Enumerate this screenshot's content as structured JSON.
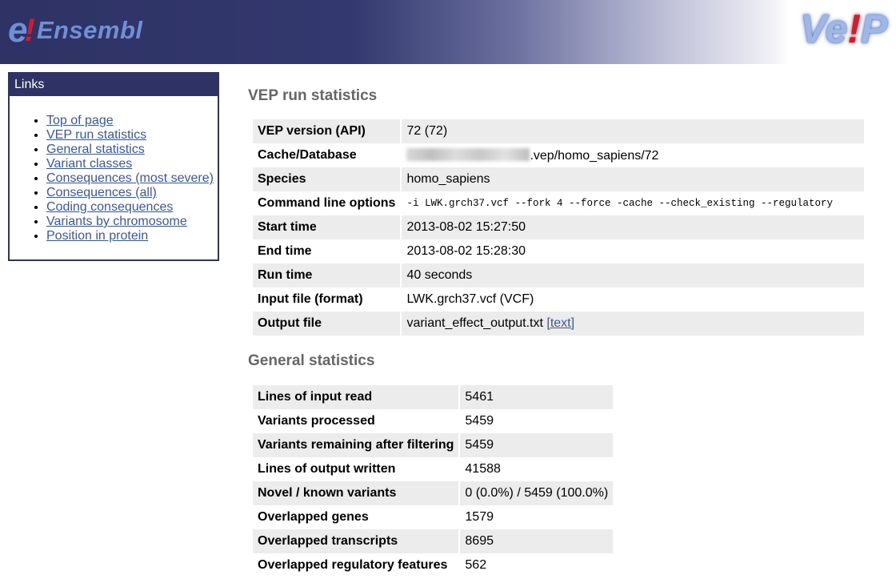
{
  "header": {
    "logo": {
      "e": "e",
      "bang": "!",
      "word": "Ensembl"
    },
    "vep_logo": {
      "prefix": "Ve",
      "bang": "!",
      "suffix": "P"
    }
  },
  "sidebar": {
    "title": "Links",
    "items": [
      {
        "label": "Top of page"
      },
      {
        "label": "VEP run statistics"
      },
      {
        "label": "General statistics"
      },
      {
        "label": "Variant classes"
      },
      {
        "label": "Consequences (most severe)"
      },
      {
        "label": "Consequences (all)"
      },
      {
        "label": "Coding consequences"
      },
      {
        "label": "Variants by chromosome"
      },
      {
        "label": "Position in protein"
      }
    ]
  },
  "run_stats": {
    "title": "VEP run statistics",
    "rows": [
      {
        "key": "VEP version (API)",
        "value": "72 (72)"
      },
      {
        "key": "Cache/Database",
        "value": ".vep/homo_sapiens/72"
      },
      {
        "key": "Species",
        "value": "homo_sapiens"
      },
      {
        "key": "Command line options",
        "value": "-i LWK.grch37.vcf --fork 4 --force -cache --check_existing --regulatory"
      },
      {
        "key": "Start time",
        "value": "2013-08-02 15:27:50"
      },
      {
        "key": "End time",
        "value": "2013-08-02 15:28:30"
      },
      {
        "key": "Run time",
        "value": "40 seconds"
      },
      {
        "key": "Input file (format)",
        "value": "LWK.grch37.vcf (VCF)"
      },
      {
        "key": "Output file",
        "value": "variant_effect_output.txt",
        "link": "[text]"
      }
    ]
  },
  "general_stats": {
    "title": "General statistics",
    "rows": [
      {
        "key": "Lines of input read",
        "value": "5461"
      },
      {
        "key": "Variants processed",
        "value": "5459"
      },
      {
        "key": "Variants remaining after filtering",
        "value": "5459"
      },
      {
        "key": "Lines of output written",
        "value": "41588"
      },
      {
        "key": "Novel / known variants",
        "value": "0 (0.0%) / 5459 (100.0%)"
      },
      {
        "key": "Overlapped genes",
        "value": "1579"
      },
      {
        "key": "Overlapped transcripts",
        "value": "8695"
      },
      {
        "key": "Overlapped regulatory features",
        "value": "562"
      }
    ]
  }
}
